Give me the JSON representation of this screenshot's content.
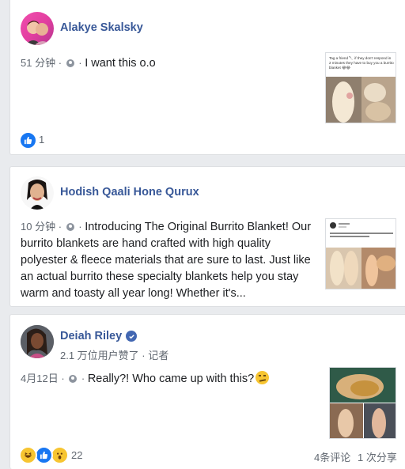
{
  "posts": [
    {
      "author": "Alakye Skalsky",
      "time": "51 分钟",
      "text": "I want this o.o",
      "thumb_caption": "Tag a friend 🔪 if they don't respond in 2 minutes they have to buy you a burrito blanket 😂😂",
      "reaction_count": "1"
    },
    {
      "author": "Hodish Qaali Hone Qurux",
      "time": "10 分钟",
      "text": "Introducing The Original Burrito Blanket! Our burrito blankets are hand crafted with high quality polyester & fleece materials that are sure to last. Just like an actual burrito these specialty blankets help you stay warm and toasty all year long! Whether it's..."
    },
    {
      "author": "Deiah Riley",
      "subtitle": "2.1 万位用户赞了 · 记者",
      "time": "4月12日",
      "text": "Really?! Who came up with this?",
      "reaction_count": "22",
      "comments": "4条评论",
      "shares": "1 次分享"
    }
  ],
  "colors": {
    "link": "#385898",
    "like_blue": "#1877f2",
    "bg": "#e9ebee"
  }
}
